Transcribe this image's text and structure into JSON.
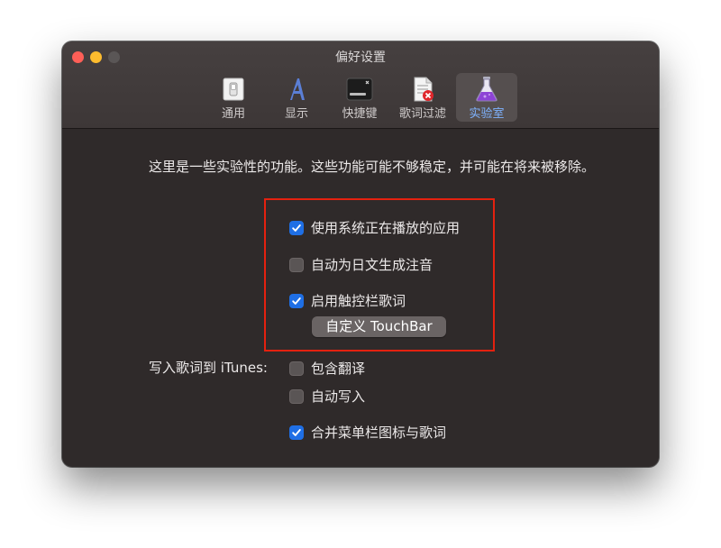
{
  "window": {
    "title": "偏好设置"
  },
  "toolbar": {
    "tabs": [
      {
        "label": "通用",
        "icon": "switch-icon"
      },
      {
        "label": "显示",
        "icon": "font-icon"
      },
      {
        "label": "快捷键",
        "icon": "command-key-icon"
      },
      {
        "label": "歌词过滤",
        "icon": "document-filter-icon"
      },
      {
        "label": "实验室",
        "icon": "flask-icon"
      }
    ],
    "active_tab": "实验室"
  },
  "lab": {
    "intro": "这里是一些实验性的功能。这些功能可能不够稳定，并可能在将来被移除。",
    "options": [
      {
        "label": "使用系统正在播放的应用",
        "checked": true
      },
      {
        "label": "自动为日文生成注音",
        "checked": false
      },
      {
        "label": "启用触控栏歌词",
        "checked": true
      }
    ],
    "customize_button": "自定义 TouchBar",
    "itunes": {
      "label": "写入歌词到 iTunes:",
      "options": [
        {
          "label": "包含翻译",
          "checked": false
        },
        {
          "label": "自动写入",
          "checked": false
        }
      ]
    },
    "merge_option": {
      "label": "合并菜单栏图标与歌词",
      "checked": true
    }
  },
  "colors": {
    "accent": "#1f6fe5",
    "highlight_box": "#e4210f",
    "active_tab_label": "#7fb3ff"
  }
}
